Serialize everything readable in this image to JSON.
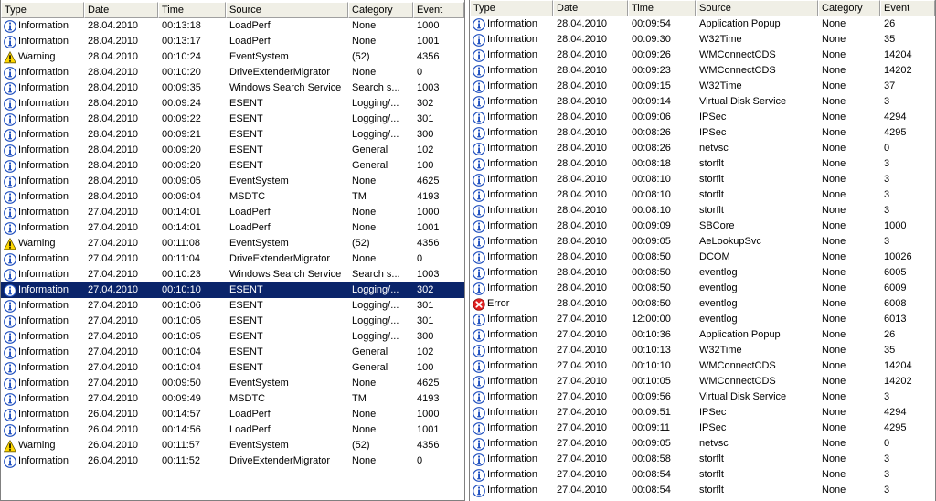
{
  "panes": [
    {
      "columns": [
        "Type",
        "Date",
        "Time",
        "Source",
        "Category",
        "Event"
      ],
      "rows": [
        {
          "type": "Information",
          "date": "28.04.2010",
          "time": "00:13:18",
          "source": "LoadPerf",
          "category": "None",
          "event": "1000"
        },
        {
          "type": "Information",
          "date": "28.04.2010",
          "time": "00:13:17",
          "source": "LoadPerf",
          "category": "None",
          "event": "1001"
        },
        {
          "type": "Warning",
          "date": "28.04.2010",
          "time": "00:10:24",
          "source": "EventSystem",
          "category": "(52)",
          "event": "4356"
        },
        {
          "type": "Information",
          "date": "28.04.2010",
          "time": "00:10:20",
          "source": "DriveExtenderMigrator",
          "category": "None",
          "event": "0"
        },
        {
          "type": "Information",
          "date": "28.04.2010",
          "time": "00:09:35",
          "source": "Windows Search Service",
          "category": "Search s...",
          "event": "1003"
        },
        {
          "type": "Information",
          "date": "28.04.2010",
          "time": "00:09:24",
          "source": "ESENT",
          "category": "Logging/...",
          "event": "302"
        },
        {
          "type": "Information",
          "date": "28.04.2010",
          "time": "00:09:22",
          "source": "ESENT",
          "category": "Logging/...",
          "event": "301"
        },
        {
          "type": "Information",
          "date": "28.04.2010",
          "time": "00:09:21",
          "source": "ESENT",
          "category": "Logging/...",
          "event": "300"
        },
        {
          "type": "Information",
          "date": "28.04.2010",
          "time": "00:09:20",
          "source": "ESENT",
          "category": "General",
          "event": "102"
        },
        {
          "type": "Information",
          "date": "28.04.2010",
          "time": "00:09:20",
          "source": "ESENT",
          "category": "General",
          "event": "100"
        },
        {
          "type": "Information",
          "date": "28.04.2010",
          "time": "00:09:05",
          "source": "EventSystem",
          "category": "None",
          "event": "4625"
        },
        {
          "type": "Information",
          "date": "28.04.2010",
          "time": "00:09:04",
          "source": "MSDTC",
          "category": "TM",
          "event": "4193"
        },
        {
          "type": "Information",
          "date": "27.04.2010",
          "time": "00:14:01",
          "source": "LoadPerf",
          "category": "None",
          "event": "1000"
        },
        {
          "type": "Information",
          "date": "27.04.2010",
          "time": "00:14:01",
          "source": "LoadPerf",
          "category": "None",
          "event": "1001"
        },
        {
          "type": "Warning",
          "date": "27.04.2010",
          "time": "00:11:08",
          "source": "EventSystem",
          "category": "(52)",
          "event": "4356"
        },
        {
          "type": "Information",
          "date": "27.04.2010",
          "time": "00:11:04",
          "source": "DriveExtenderMigrator",
          "category": "None",
          "event": "0"
        },
        {
          "type": "Information",
          "date": "27.04.2010",
          "time": "00:10:23",
          "source": "Windows Search Service",
          "category": "Search s...",
          "event": "1003"
        },
        {
          "type": "Information",
          "date": "27.04.2010",
          "time": "00:10:10",
          "source": "ESENT",
          "category": "Logging/...",
          "event": "302",
          "selected": true
        },
        {
          "type": "Information",
          "date": "27.04.2010",
          "time": "00:10:06",
          "source": "ESENT",
          "category": "Logging/...",
          "event": "301"
        },
        {
          "type": "Information",
          "date": "27.04.2010",
          "time": "00:10:05",
          "source": "ESENT",
          "category": "Logging/...",
          "event": "301"
        },
        {
          "type": "Information",
          "date": "27.04.2010",
          "time": "00:10:05",
          "source": "ESENT",
          "category": "Logging/...",
          "event": "300"
        },
        {
          "type": "Information",
          "date": "27.04.2010",
          "time": "00:10:04",
          "source": "ESENT",
          "category": "General",
          "event": "102"
        },
        {
          "type": "Information",
          "date": "27.04.2010",
          "time": "00:10:04",
          "source": "ESENT",
          "category": "General",
          "event": "100"
        },
        {
          "type": "Information",
          "date": "27.04.2010",
          "time": "00:09:50",
          "source": "EventSystem",
          "category": "None",
          "event": "4625"
        },
        {
          "type": "Information",
          "date": "27.04.2010",
          "time": "00:09:49",
          "source": "MSDTC",
          "category": "TM",
          "event": "4193"
        },
        {
          "type": "Information",
          "date": "26.04.2010",
          "time": "00:14:57",
          "source": "LoadPerf",
          "category": "None",
          "event": "1000"
        },
        {
          "type": "Information",
          "date": "26.04.2010",
          "time": "00:14:56",
          "source": "LoadPerf",
          "category": "None",
          "event": "1001"
        },
        {
          "type": "Warning",
          "date": "26.04.2010",
          "time": "00:11:57",
          "source": "EventSystem",
          "category": "(52)",
          "event": "4356"
        },
        {
          "type": "Information",
          "date": "26.04.2010",
          "time": "00:11:52",
          "source": "DriveExtenderMigrator",
          "category": "None",
          "event": "0"
        }
      ]
    },
    {
      "columns": [
        "Type",
        "Date",
        "Time",
        "Source",
        "Category",
        "Event"
      ],
      "rows": [
        {
          "type": "Information",
          "date": "28.04.2010",
          "time": "00:09:54",
          "source": "Application Popup",
          "category": "None",
          "event": "26"
        },
        {
          "type": "Information",
          "date": "28.04.2010",
          "time": "00:09:30",
          "source": "W32Time",
          "category": "None",
          "event": "35"
        },
        {
          "type": "Information",
          "date": "28.04.2010",
          "time": "00:09:26",
          "source": "WMConnectCDS",
          "category": "None",
          "event": "14204"
        },
        {
          "type": "Information",
          "date": "28.04.2010",
          "time": "00:09:23",
          "source": "WMConnectCDS",
          "category": "None",
          "event": "14202"
        },
        {
          "type": "Information",
          "date": "28.04.2010",
          "time": "00:09:15",
          "source": "W32Time",
          "category": "None",
          "event": "37"
        },
        {
          "type": "Information",
          "date": "28.04.2010",
          "time": "00:09:14",
          "source": "Virtual Disk Service",
          "category": "None",
          "event": "3"
        },
        {
          "type": "Information",
          "date": "28.04.2010",
          "time": "00:09:06",
          "source": "IPSec",
          "category": "None",
          "event": "4294"
        },
        {
          "type": "Information",
          "date": "28.04.2010",
          "time": "00:08:26",
          "source": "IPSec",
          "category": "None",
          "event": "4295"
        },
        {
          "type": "Information",
          "date": "28.04.2010",
          "time": "00:08:26",
          "source": "netvsc",
          "category": "None",
          "event": "0"
        },
        {
          "type": "Information",
          "date": "28.04.2010",
          "time": "00:08:18",
          "source": "storflt",
          "category": "None",
          "event": "3"
        },
        {
          "type": "Information",
          "date": "28.04.2010",
          "time": "00:08:10",
          "source": "storflt",
          "category": "None",
          "event": "3"
        },
        {
          "type": "Information",
          "date": "28.04.2010",
          "time": "00:08:10",
          "source": "storflt",
          "category": "None",
          "event": "3"
        },
        {
          "type": "Information",
          "date": "28.04.2010",
          "time": "00:08:10",
          "source": "storflt",
          "category": "None",
          "event": "3"
        },
        {
          "type": "Information",
          "date": "28.04.2010",
          "time": "00:09:09",
          "source": "SBCore",
          "category": "None",
          "event": "1000"
        },
        {
          "type": "Information",
          "date": "28.04.2010",
          "time": "00:09:05",
          "source": "AeLookupSvc",
          "category": "None",
          "event": "3"
        },
        {
          "type": "Information",
          "date": "28.04.2010",
          "time": "00:08:50",
          "source": "DCOM",
          "category": "None",
          "event": "10026"
        },
        {
          "type": "Information",
          "date": "28.04.2010",
          "time": "00:08:50",
          "source": "eventlog",
          "category": "None",
          "event": "6005"
        },
        {
          "type": "Information",
          "date": "28.04.2010",
          "time": "00:08:50",
          "source": "eventlog",
          "category": "None",
          "event": "6009"
        },
        {
          "type": "Error",
          "date": "28.04.2010",
          "time": "00:08:50",
          "source": "eventlog",
          "category": "None",
          "event": "6008"
        },
        {
          "type": "Information",
          "date": "27.04.2010",
          "time": "12:00:00",
          "source": "eventlog",
          "category": "None",
          "event": "6013"
        },
        {
          "type": "Information",
          "date": "27.04.2010",
          "time": "00:10:36",
          "source": "Application Popup",
          "category": "None",
          "event": "26"
        },
        {
          "type": "Information",
          "date": "27.04.2010",
          "time": "00:10:13",
          "source": "W32Time",
          "category": "None",
          "event": "35"
        },
        {
          "type": "Information",
          "date": "27.04.2010",
          "time": "00:10:10",
          "source": "WMConnectCDS",
          "category": "None",
          "event": "14204"
        },
        {
          "type": "Information",
          "date": "27.04.2010",
          "time": "00:10:05",
          "source": "WMConnectCDS",
          "category": "None",
          "event": "14202"
        },
        {
          "type": "Information",
          "date": "27.04.2010",
          "time": "00:09:56",
          "source": "Virtual Disk Service",
          "category": "None",
          "event": "3"
        },
        {
          "type": "Information",
          "date": "27.04.2010",
          "time": "00:09:51",
          "source": "IPSec",
          "category": "None",
          "event": "4294"
        },
        {
          "type": "Information",
          "date": "27.04.2010",
          "time": "00:09:11",
          "source": "IPSec",
          "category": "None",
          "event": "4295"
        },
        {
          "type": "Information",
          "date": "27.04.2010",
          "time": "00:09:05",
          "source": "netvsc",
          "category": "None",
          "event": "0"
        },
        {
          "type": "Information",
          "date": "27.04.2010",
          "time": "00:08:58",
          "source": "storflt",
          "category": "None",
          "event": "3"
        },
        {
          "type": "Information",
          "date": "27.04.2010",
          "time": "00:08:54",
          "source": "storflt",
          "category": "None",
          "event": "3"
        },
        {
          "type": "Information",
          "date": "27.04.2010",
          "time": "00:08:54",
          "source": "storflt",
          "category": "None",
          "event": "3"
        }
      ]
    }
  ],
  "icons": {
    "Information": "information-icon",
    "Warning": "warning-icon",
    "Error": "error-icon"
  },
  "colors": {
    "selection": "#0a246a",
    "info_blue": "#1f4fbf",
    "warning_yellow": "#ffd800",
    "error_red": "#e02020"
  }
}
